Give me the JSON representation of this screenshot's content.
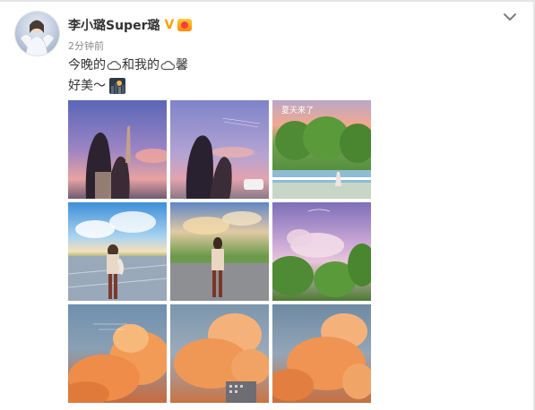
{
  "post": {
    "author_name": "李小璐Super璐",
    "verified_badge": "V",
    "timestamp": "2分钟前",
    "line1": {
      "segments": [
        "今晚的",
        "和我的",
        "馨"
      ]
    },
    "line2": {
      "text": "好美～"
    }
  },
  "icons": {
    "verified": "verified-badge-icon",
    "vip": "vip-crown-icon",
    "cloud": "cloud-icon",
    "emoji": "sunset-city-emoji-icon",
    "menu": "chevron-down-icon"
  },
  "photos": [
    {
      "name": "photo-sunset-friends-1",
      "overlay_text": ""
    },
    {
      "name": "photo-sunset-friends-2",
      "overlay_text": ""
    },
    {
      "name": "photo-park-trees",
      "overlay_text": "夏天来了"
    },
    {
      "name": "photo-couple-hug-plaza",
      "overlay_text": ""
    },
    {
      "name": "photo-girl-standing-plaza",
      "overlay_text": ""
    },
    {
      "name": "photo-pink-clouds-trees",
      "overlay_text": ""
    },
    {
      "name": "photo-orange-cloud-1",
      "overlay_text": ""
    },
    {
      "name": "photo-orange-cloud-2",
      "overlay_text": ""
    },
    {
      "name": "photo-orange-cloud-3",
      "overlay_text": ""
    }
  ],
  "colors": {
    "name": "#333333",
    "text": "#333333",
    "muted": "#8a8a8a",
    "verified": "#f5a300"
  }
}
